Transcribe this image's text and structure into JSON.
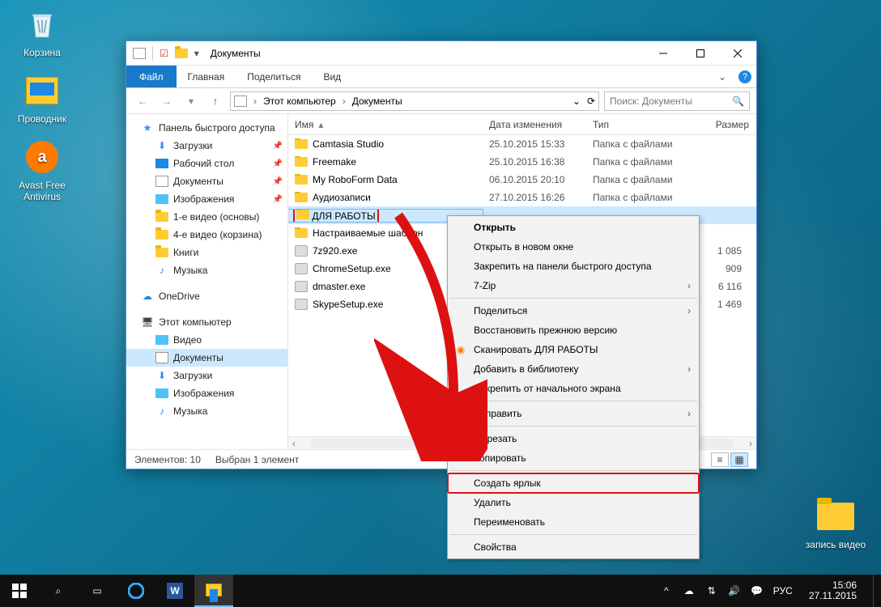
{
  "desktop_icons": {
    "recycle": "Корзина",
    "explorer": "Проводник",
    "avast": "Avast Free Antivirus",
    "video_rec": "запись видео"
  },
  "window": {
    "title": "Документы",
    "tabs": {
      "file": "Файл",
      "home": "Главная",
      "share": "Поделиться",
      "view": "Вид"
    },
    "breadcrumb": {
      "root": "Этот компьютер",
      "current": "Документы"
    },
    "search_placeholder": "Поиск: Документы",
    "columns": {
      "name": "Имя",
      "date": "Дата изменения",
      "type": "Тип",
      "size": "Размер"
    },
    "status": {
      "count": "Элементов: 10",
      "sel": "Выбран 1 элемент"
    }
  },
  "tree": {
    "quick": "Панель быстрого доступа",
    "downloads": "Загрузки",
    "desktop": "Рабочий стол",
    "documents": "Документы",
    "pictures": "Изображения",
    "vid1": "1-е видео (основы)",
    "vid4": "4-е видео (корзина)",
    "books": "Книги",
    "music": "Музыка",
    "onedrive": "OneDrive",
    "thispc": "Этот компьютер",
    "video": "Видео",
    "documents2": "Документы",
    "downloads2": "Загрузки",
    "pictures2": "Изображения",
    "music2": "Музыка"
  },
  "rows": [
    {
      "name": "Camtasia Studio",
      "date": "25.10.2015 15:33",
      "type": "Папка с файлами",
      "size": "",
      "icon": "folder"
    },
    {
      "name": "Freemake",
      "date": "25.10.2015 16:38",
      "type": "Папка с файлами",
      "size": "",
      "icon": "folder"
    },
    {
      "name": "My RoboForm Data",
      "date": "06.10.2015 20:10",
      "type": "Папка с файлами",
      "size": "",
      "icon": "folder"
    },
    {
      "name": "Аудиозаписи",
      "date": "27.10.2015 16:26",
      "type": "Папка с файлами",
      "size": "",
      "icon": "folder"
    },
    {
      "name": "ДЛЯ РАБОТЫ",
      "date": "",
      "type": "",
      "size": "",
      "icon": "folder",
      "selected": true
    },
    {
      "name": "Настраиваемые шаблон",
      "date": "",
      "type": "",
      "size": "",
      "icon": "folder"
    },
    {
      "name": "7z920.exe",
      "date": "",
      "type": "",
      "size": "1 085",
      "icon": "app"
    },
    {
      "name": "ChromeSetup.exe",
      "date": "",
      "type": "",
      "size": "909",
      "icon": "app"
    },
    {
      "name": "dmaster.exe",
      "date": "",
      "type": "",
      "size": "6 116",
      "icon": "app"
    },
    {
      "name": "SkypeSetup.exe",
      "date": "",
      "type": "",
      "size": "1 469",
      "icon": "app"
    }
  ],
  "ctx": {
    "open": "Открыть",
    "open_new": "Открыть в новом окне",
    "pin_quick": "Закрепить на панели быстрого доступа",
    "sevenzip": "7-Zip",
    "share": "Поделиться",
    "restore": "Восстановить прежнюю версию",
    "scan": "Сканировать ДЛЯ РАБОТЫ",
    "add_lib": "Добавить в библиотеку",
    "unpin_start": "Открепить от начального экрана",
    "send_to": "Отправить",
    "cut": "Вырезать",
    "copy": "Копировать",
    "shortcut": "Создать ярлык",
    "delete": "Удалить",
    "rename": "Переименовать",
    "props": "Свойства"
  },
  "taskbar": {
    "lang": "РУС",
    "time": "15:06",
    "date": "27.11.2015"
  }
}
